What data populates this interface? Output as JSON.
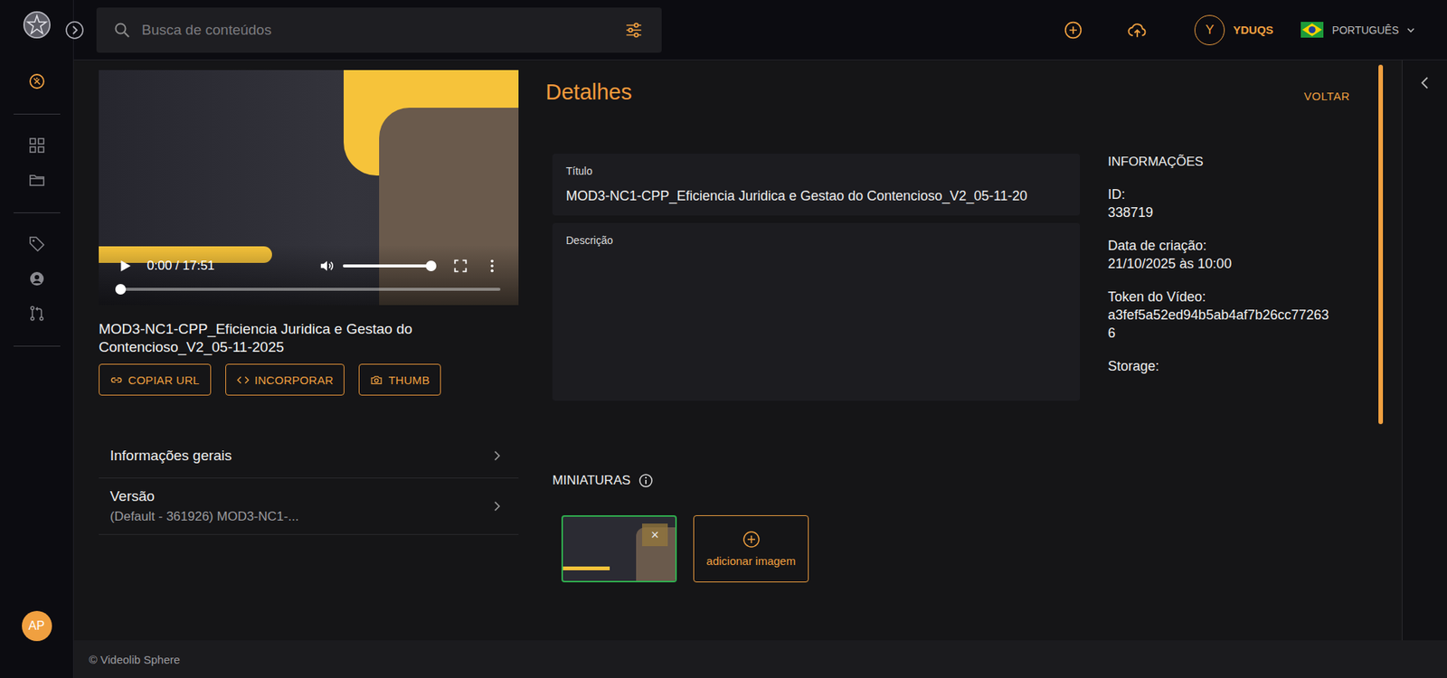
{
  "sidebar": {
    "groups": [
      {
        "items": [
          {
            "selected": true
          }
        ]
      },
      {
        "items": [
          {
            "selected": false
          },
          {
            "selected": false
          }
        ]
      },
      {
        "items": [
          {
            "selected": false
          },
          {
            "selected": false
          },
          {
            "selected": false
          }
        ]
      }
    ],
    "user_avatar": "AP"
  },
  "header": {
    "search": {
      "placeholder": "Busca de conteúdos"
    },
    "account": {
      "initial": "Y",
      "name": "YDUQS"
    },
    "language": "PORTUGUÊS"
  },
  "player": {
    "time": "0:00 / 17:51",
    "progress": 0,
    "volume": 1
  },
  "video": {
    "title": "MOD3-NC1-CPP_Eficiencia Juridica e Gestao do Contencioso_V2_05-11-2025",
    "buttons": [
      "COPIAR URL",
      "INCORPORAR",
      "THUMB"
    ]
  },
  "sections": [
    {
      "label": "Informações gerais",
      "value": ""
    },
    {
      "label": "Versão",
      "value": "(Default - 361926) MOD3-NC1-..."
    }
  ],
  "details": {
    "heading": "Detalhes",
    "back": "VOLTAR",
    "fields": [
      {
        "label": "Título",
        "value": "MOD3-NC1-CPP_Eficiencia Juridica e Gestao do Contencioso_V2_05-11-20"
      },
      {
        "label": "Descrição",
        "value": ""
      }
    ],
    "info": {
      "heading": "INFORMAÇÕES",
      "items": [
        {
          "label": "ID:",
          "value": "338719"
        },
        {
          "label": "Data de criação:",
          "value": "21/10/2025 às 10:00"
        },
        {
          "label": "Token do Vídeo:",
          "value": "a3fef5a52ed94b5ab4af7b26cc772636"
        },
        {
          "label": "Storage:",
          "value": ""
        }
      ]
    }
  },
  "thumbnails": {
    "heading": "MINIATURAS",
    "items": [
      {
        "selected": true,
        "remove": "×"
      }
    ],
    "add": "adicionar imagem"
  },
  "footer": "© Videolib Sphere"
}
